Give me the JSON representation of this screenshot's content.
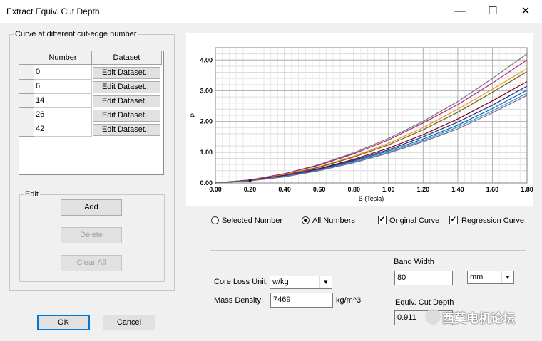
{
  "window": {
    "title": "Extract Equiv. Cut Depth",
    "minimize": "—",
    "maximize": "☐",
    "close": "✕"
  },
  "curve_group": {
    "label": "Curve at different cut-edge number",
    "columns": [
      "Number",
      "Dataset"
    ],
    "rows": [
      {
        "number": "0",
        "dataset": "Edit Dataset..."
      },
      {
        "number": "6",
        "dataset": "Edit Dataset..."
      },
      {
        "number": "14",
        "dataset": "Edit Dataset..."
      },
      {
        "number": "26",
        "dataset": "Edit Dataset..."
      },
      {
        "number": "42",
        "dataset": "Edit Dataset..."
      }
    ]
  },
  "edit_group": {
    "label": "Edit",
    "add": "Add",
    "delete": "Delete",
    "clear_all": "Clear All"
  },
  "footer": {
    "ok": "OK",
    "cancel": "Cancel"
  },
  "options": {
    "selected_number": "Selected Number",
    "all_numbers": "All Numbers",
    "original_curve": "Original Curve",
    "regression_curve": "Regression Curve",
    "selected_mode": "all_numbers",
    "original_checked": true,
    "regression_checked": true
  },
  "params": {
    "core_loss_unit_label": "Core Loss Unit:",
    "core_loss_unit_value": "w/kg",
    "mass_density_label": "Mass Density:",
    "mass_density_value": "7469",
    "mass_density_unit": "kg/m^3",
    "band_width_label": "Band Width",
    "band_width_value": "80",
    "band_width_unit": "mm",
    "equiv_cut_depth_label": "Equiv. Cut Depth",
    "equiv_cut_depth_value": "0.911"
  },
  "watermark": "西莫电机论坛",
  "chart_data": {
    "type": "line",
    "xlabel": "B (Tesla)",
    "ylabel": "P",
    "xlim": [
      0,
      1.8
    ],
    "ylim": [
      0,
      4.4
    ],
    "xticks": [
      "0.00",
      "0.20",
      "0.40",
      "0.60",
      "0.80",
      "1.00",
      "1.20",
      "1.40",
      "1.60",
      "1.80"
    ],
    "yticks": [
      "0.00",
      "1.00",
      "2.00",
      "3.00",
      "4.00"
    ],
    "grid": true,
    "x": [
      0,
      0.2,
      0.4,
      0.6,
      0.8,
      1.0,
      1.2,
      1.4,
      1.6,
      1.8
    ],
    "series": [
      {
        "color": "#777777",
        "values": [
          0,
          0.1,
          0.3,
          0.6,
          0.98,
          1.45,
          2.0,
          2.65,
          3.4,
          4.2
        ]
      },
      {
        "color": "#b0208c",
        "values": [
          0,
          0.1,
          0.3,
          0.58,
          0.95,
          1.4,
          1.95,
          2.55,
          3.25,
          4.0
        ]
      },
      {
        "color": "#e0a020",
        "values": [
          0,
          0.09,
          0.27,
          0.53,
          0.87,
          1.29,
          1.8,
          2.4,
          3.05,
          3.72
        ]
      },
      {
        "color": "#7a5a10",
        "values": [
          0,
          0.09,
          0.26,
          0.51,
          0.84,
          1.24,
          1.73,
          2.3,
          2.95,
          3.62
        ]
      },
      {
        "color": "#800020",
        "values": [
          0,
          0.08,
          0.24,
          0.47,
          0.77,
          1.13,
          1.57,
          2.08,
          2.67,
          3.3
        ]
      },
      {
        "color": "#203070",
        "values": [
          0,
          0.08,
          0.23,
          0.45,
          0.74,
          1.08,
          1.5,
          1.98,
          2.53,
          3.15
        ]
      },
      {
        "color": "#1060d0",
        "values": [
          0,
          0.07,
          0.22,
          0.43,
          0.71,
          1.04,
          1.43,
          1.88,
          2.42,
          3.02
        ]
      },
      {
        "color": "#20a0c0",
        "values": [
          0,
          0.07,
          0.21,
          0.41,
          0.68,
          1.0,
          1.38,
          1.82,
          2.34,
          2.92
        ]
      },
      {
        "color": "#8a6080",
        "values": [
          0,
          0.07,
          0.2,
          0.4,
          0.66,
          0.97,
          1.34,
          1.76,
          2.28,
          2.85
        ]
      }
    ]
  }
}
